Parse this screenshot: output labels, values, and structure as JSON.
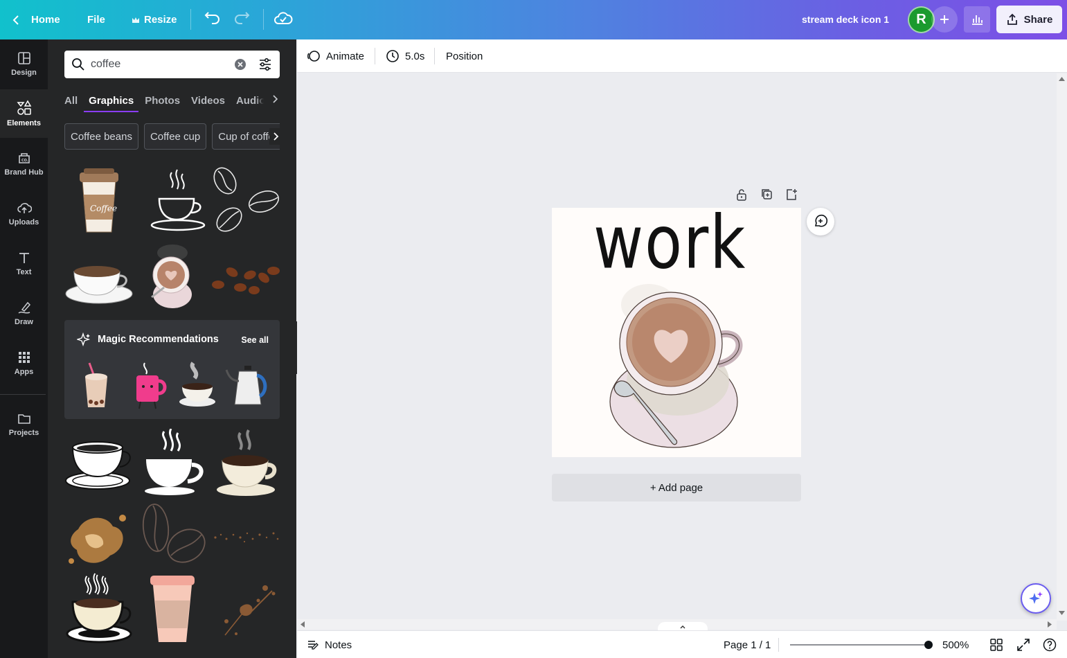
{
  "topbar": {
    "home_label": "Home",
    "file_label": "File",
    "resize_label": "Resize",
    "design_title": "stream deck icon 1",
    "avatar_initial": "R",
    "share_label": "Share"
  },
  "rail": {
    "items": [
      {
        "label": "Design",
        "icon": "design-icon"
      },
      {
        "label": "Elements",
        "icon": "elements-icon"
      },
      {
        "label": "Brand Hub",
        "icon": "brand-hub-icon"
      },
      {
        "label": "Uploads",
        "icon": "upload-icon"
      },
      {
        "label": "Text",
        "icon": "text-icon"
      },
      {
        "label": "Draw",
        "icon": "draw-icon"
      },
      {
        "label": "Apps",
        "icon": "apps-icon"
      },
      {
        "label": "Projects",
        "icon": "folder-icon"
      }
    ]
  },
  "panel": {
    "search_value": "coffee",
    "tabs": [
      "All",
      "Graphics",
      "Photos",
      "Videos",
      "Audio"
    ],
    "active_tab": "Graphics",
    "chips": [
      "Coffee beans",
      "Coffee cup",
      "Cup of coffee"
    ],
    "magic_title": "Magic Recommendations",
    "see_all": "See all"
  },
  "editor": {
    "animate_label": "Animate",
    "duration_label": "5.0s",
    "position_label": "Position",
    "canvas_text": "work",
    "add_page_label": "+ Add page"
  },
  "bottombar": {
    "notes_label": "Notes",
    "page_label": "Page 1 / 1",
    "zoom_label": "500%"
  },
  "colors": {
    "accent": "#8b3dff",
    "avatar": "#1a9a2e",
    "panel_bg": "#252627",
    "rail_bg": "#18191b"
  }
}
